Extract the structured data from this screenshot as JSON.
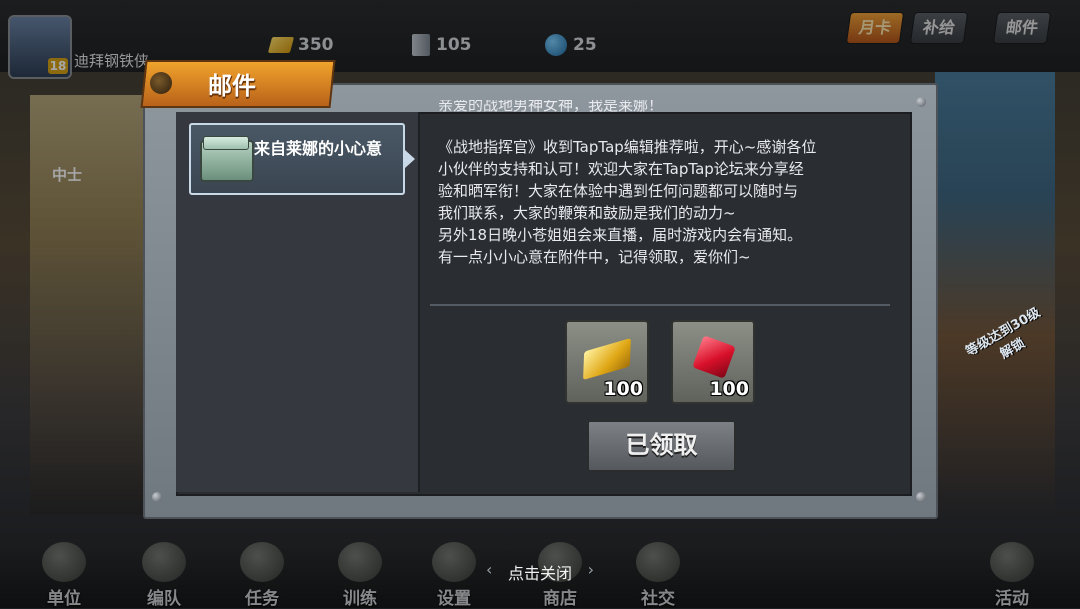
{
  "topbar": {
    "player_name": "迪拜钢铁侠",
    "level": "18",
    "gold": "350",
    "scrolls": "105",
    "gems": "25",
    "btn_event": "月卡",
    "btn_supply": "补给",
    "btn_mail": "邮件"
  },
  "sidebar": {
    "rank": "中士"
  },
  "dialog": {
    "title": "邮件",
    "mail_item_title": "来自莱娜的小心意",
    "greeting": "亲爱的战地男神女神，我是莱娜！",
    "body": [
      "《战地指挥官》收到TapTap编辑推荐啦，开心~感谢各位",
      "小伙伴的支持和认可！欢迎大家在TapTap论坛来分享经",
      "验和晒军衔！大家在体验中遇到任何问题都可以随时与",
      "我们联系，大家的鞭策和鼓励是我们的动力~",
      "另外18日晚小苍姐姐会来直播，届时游戏内会有通知。",
      "有一点小小心意在附件中，记得领取，爱你们~"
    ],
    "rewards": [
      {
        "icon": "gold-bar-icon",
        "qty": "100"
      },
      {
        "icon": "ruby-icon",
        "qty": "100"
      }
    ],
    "claim_button": "已领取"
  },
  "right_badge": "等级达到30级解锁",
  "bottom_nav": {
    "items": [
      "单位",
      "编队",
      "任务",
      "训练",
      "设置",
      "商店",
      "社交",
      "活动"
    ],
    "close_hint": "点击关闭"
  }
}
